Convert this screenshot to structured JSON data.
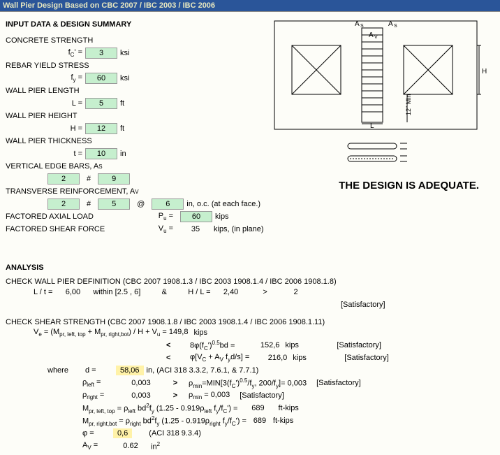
{
  "title": "Wall Pier Design Based on CBC 2007 / IBC 2003 / IBC 2006",
  "headings": {
    "input": "INPUT DATA & DESIGN SUMMARY",
    "analysis": "ANALYSIS"
  },
  "inputs": {
    "concrete_strength": {
      "label": "CONCRETE STRENGTH",
      "sym": "f",
      "sub": "C",
      "prime": "'",
      "eq": " =",
      "val": "3",
      "unit": "ksi"
    },
    "rebar_yield": {
      "label": "REBAR YIELD STRESS",
      "sym": "f",
      "sub": "y",
      "eq": " =",
      "val": "60",
      "unit": "ksi"
    },
    "length": {
      "label": "WALL PIER LENGTH",
      "sym": "L =",
      "val": "5",
      "unit": "ft"
    },
    "height": {
      "label": "WALL PIER HEIGHT",
      "sym": "H =",
      "val": "12",
      "unit": "ft"
    },
    "thickness": {
      "label": "WALL PIER THICKNESS",
      "sym": "t =",
      "val": "10",
      "unit": "in"
    },
    "vert_edge": {
      "label": "VERTICAL EDGE BARS, A",
      "sub": "S",
      "n": "2",
      "hash": "#",
      "size": "9"
    },
    "transverse": {
      "label": "TRANSVERSE REINFORCEMENT, A",
      "sub": "V",
      "n": "2",
      "hash": "#",
      "size": "5",
      "at": "@",
      "spacing": "6",
      "unit": "in, o.c. (at each face.)"
    },
    "axial": {
      "label": "FACTORED AXIAL LOAD",
      "sym": "P",
      "sub": "u",
      "eq": " =",
      "val": "60",
      "unit": "kips"
    },
    "shear": {
      "label": "FACTORED SHEAR FORCE",
      "sym": "V",
      "sub": "u",
      "eq": " =",
      "val": "35",
      "unit": "kips, (in plane)"
    }
  },
  "adequate": "THE DESIGN IS ADEQUATE.",
  "diagram_labels": {
    "As_left": "A",
    "As_right": "A",
    "Av": "A",
    "H": "H",
    "L": "L",
    "min": "12\" Min",
    "sub_s": "S",
    "sub_v": "V"
  },
  "check_def": {
    "title": "CHECK WALL PIER DEFINITION (CBC 2007 1908.1.3 / IBC 2003 1908.1.4 / IBC 2006 1908.1.8)",
    "lt_label": "L / t  =",
    "lt_val": "6,00",
    "within": "within [2.5 , 6]",
    "amp": "&",
    "hl_label": "H / L =",
    "hl_val": "2,40",
    "gt": ">",
    "lim": "2",
    "sat": "[Satisfactory]"
  },
  "check_shear": {
    "title": "CHECK SHEAR STRENGTH (CBC 2007 1908.1.8 / IBC 2003 1908.1.4 / IBC 2006 1908.1.11)",
    "ve_expr": "V",
    "ve_sub": "e",
    "ve_eq": " = (M",
    "ve_eq2": " + M",
    "ve_eq3": ") / H + V",
    "ve_eq4": " =  149,8",
    "ve_unit": "kips",
    "mpr_lt": "pr, left, top",
    "mpr_rb": "pr, right,bot",
    "vu": "u",
    "lt1": "<",
    "phi8": "8φ(f",
    "phi8_2": "')",
    "phi8_3": "bd =",
    "phi8_val": "152,6",
    "phi8_unit": "kips",
    "sat": "[Satisfactory]",
    "lt2": "<",
    "phivc": "φ[V",
    "phivc_2": " + A",
    "phivc_3": " f",
    "phivc_4": "d/s] =",
    "phivc_val": "216,0",
    "phivc_unit": "kips",
    "where": "where",
    "d_label": "d =",
    "d_val": "58,06",
    "d_unit": "in, (ACI 318 3.3.2, 7.6.1, & 7.7.1)",
    "rho_l": "ρ",
    "rho_l_sub": "left",
    "rho_l_eq": " =",
    "rho_l_val": "0,003",
    "gt": ">",
    "rhomin_expr": "ρ",
    "rhomin_sub": "min",
    "rhomin_eq": "=MIN[3(f",
    "rhomin_eq2": "')",
    "rhomin_eq3": "/f",
    "rhomin_eq4": ", 200/f",
    "rhomin_eq5": "]=  0,003",
    "rho_r": "ρ",
    "rho_r_sub": "right",
    "rho_r_eq": " =",
    "rho_r_val": "0,003",
    "rhomin2": "ρ",
    "rhomin2_eq": "  =   0,003",
    "mpr_lt_full": "M",
    "mpr_lt_expr": " = ρ",
    "mpr_lt_expr2": " bd",
    "mpr_lt_expr3": "f",
    "mpr_lt_expr4": " (1.25 - 0.919ρ",
    "mpr_lt_expr5": " f",
    "mpr_lt_expr6": "/f",
    "mpr_lt_expr7": "') =",
    "mpr_lt_val": "689",
    "mpr_unit": "ft-kips",
    "mpr_rb_full": "M",
    "mpr_rb_expr": " = ρ",
    "mpr_rb_expr2": " bd",
    "mpr_rb_expr3": "f",
    "mpr_rb_expr4": " (1.25 - 0.919ρ",
    "mpr_rb_expr5": " f",
    "mpr_rb_expr6": "/f",
    "mpr_rb_expr7": "') =",
    "mpr_rb_val": "689",
    "phi": "φ   =",
    "phi_val": "0,6",
    "phi_ref": "(ACI 318 9.3.4)",
    "av": "A",
    "av_sub": "V",
    "av_eq": " =",
    "av_val": "0.62",
    "av_unit": "in",
    "c_sub": "C",
    "v_sub": "V",
    "y_sub": "y",
    "half": "0.5",
    "two": "2",
    "left": "left",
    "right": "right",
    "min": "min"
  }
}
